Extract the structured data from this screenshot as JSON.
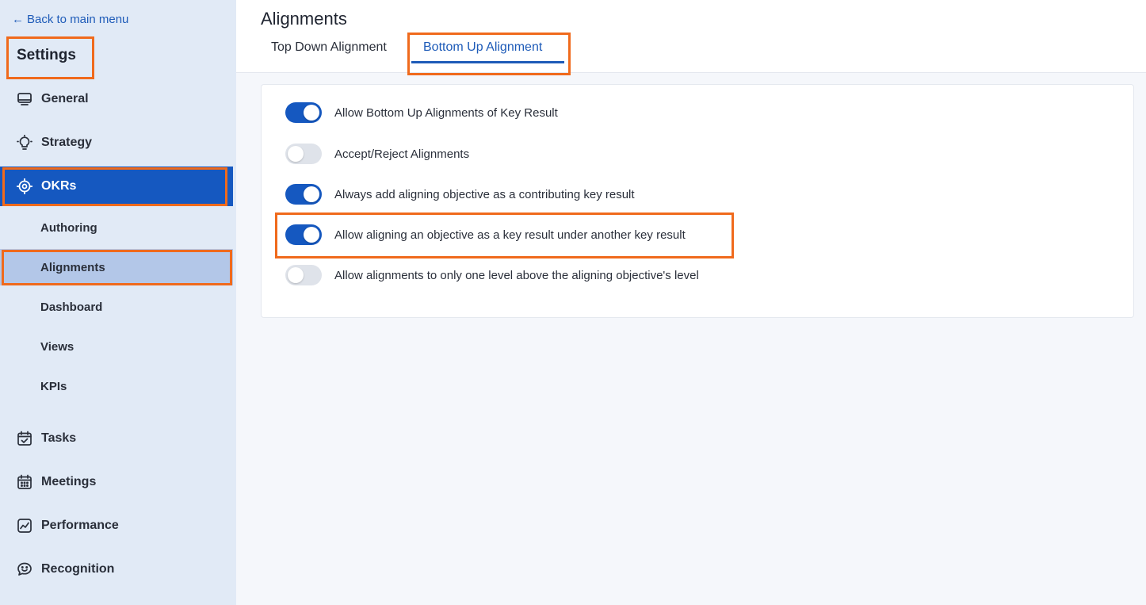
{
  "sidebar": {
    "back_label": "Back to main menu",
    "title": "Settings",
    "items": [
      {
        "label": "General",
        "icon": "monitor-icon"
      },
      {
        "label": "Strategy",
        "icon": "lightbulb-icon"
      },
      {
        "label": "OKRs",
        "icon": "target-icon",
        "active": true
      },
      {
        "label": "Tasks",
        "icon": "calendar-check-icon"
      },
      {
        "label": "Meetings",
        "icon": "calendar-grid-icon"
      },
      {
        "label": "Performance",
        "icon": "chart-line-icon"
      },
      {
        "label": "Recognition",
        "icon": "chat-smile-icon"
      }
    ],
    "sub_items": [
      {
        "label": "Authoring"
      },
      {
        "label": "Alignments",
        "active": true
      },
      {
        "label": "Dashboard"
      },
      {
        "label": "Views"
      },
      {
        "label": "KPIs"
      }
    ]
  },
  "header": {
    "title": "Alignments",
    "tabs": [
      {
        "label": "Top Down Alignment",
        "active": false
      },
      {
        "label": "Bottom Up Alignment",
        "active": true
      }
    ]
  },
  "settings": [
    {
      "label": "Allow Bottom Up Alignments of Key Result",
      "enabled": true
    },
    {
      "label": "Accept/Reject Alignments",
      "enabled": false
    },
    {
      "label": "Always add aligning objective as a contributing key result",
      "enabled": true
    },
    {
      "label": "Allow aligning an objective as a key result under another key result",
      "enabled": true
    },
    {
      "label": "Allow alignments to only one level above the aligning objective's level",
      "enabled": false
    }
  ],
  "colors": {
    "accent": "#1558c0",
    "link": "#1e5bb8",
    "highlight": "#f06a1c",
    "sidebar_bg": "#e1eaf6"
  }
}
